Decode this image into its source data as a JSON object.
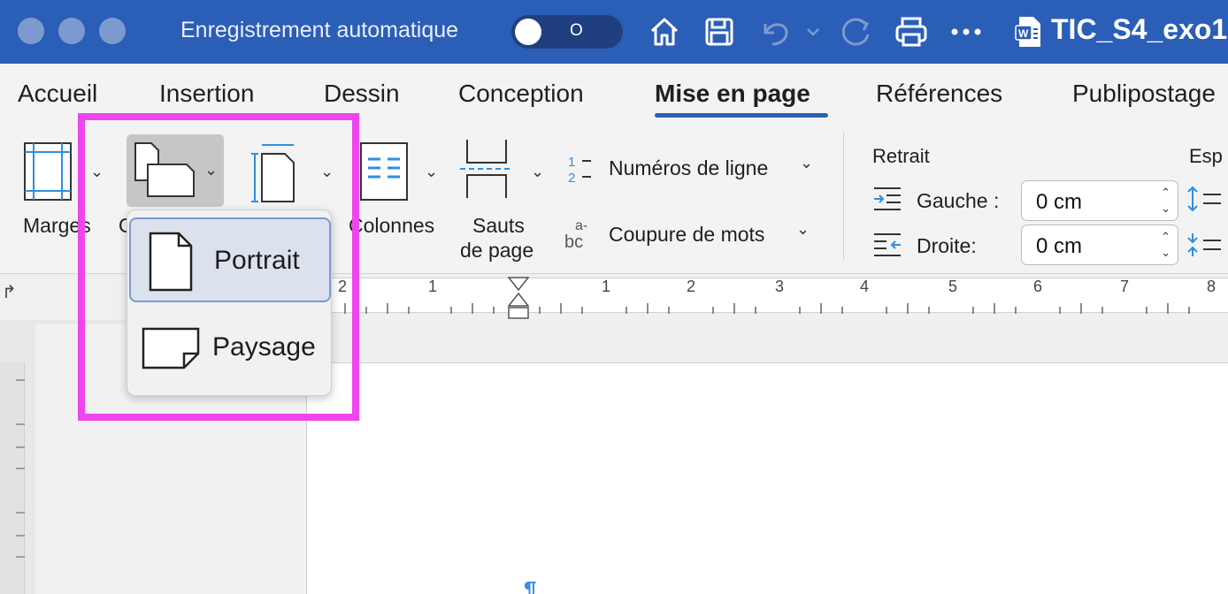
{
  "titlebar": {
    "autosave_label": "Enregistrement automatique",
    "toggle_state": "O",
    "document_title": "TIC_S4_exo1",
    "icons": [
      "home-icon",
      "save-icon",
      "undo-icon",
      "redo-icon",
      "print-icon",
      "more-icon",
      "word-doc-icon"
    ]
  },
  "tabs": [
    {
      "label": "Accueil"
    },
    {
      "label": "Insertion"
    },
    {
      "label": "Dessin"
    },
    {
      "label": "Conception"
    },
    {
      "label": "Mise en page",
      "active": true
    },
    {
      "label": "Références"
    },
    {
      "label": "Publipostage"
    }
  ],
  "ribbon": {
    "margins_label": "Marges",
    "orientation_label_partial": "O",
    "columns_label": "Colonnes",
    "breaks_label_line1": "Sauts",
    "breaks_label_line2": "de page",
    "line_numbers_label": "Numéros de ligne",
    "hyphenation_label": "Coupure de mots",
    "indent_group_label": "Retrait",
    "indent_left_label": "Gauche :",
    "indent_left_value": "0 cm",
    "indent_right_label": "Droite:",
    "indent_right_value": "0 cm",
    "spacing_group_label_partial": "Esp"
  },
  "orientation_menu": {
    "items": [
      {
        "label": "Portrait",
        "selected": true
      },
      {
        "label": "Paysage",
        "selected": false
      }
    ]
  },
  "ruler": {
    "labels": [
      "2",
      "1",
      "1",
      "2",
      "3",
      "4",
      "5",
      "6",
      "7",
      "8"
    ]
  },
  "colors": {
    "titlebar": "#2b5eb6",
    "highlight": "#ef45ef",
    "selected_item": "#dbe2ee"
  }
}
